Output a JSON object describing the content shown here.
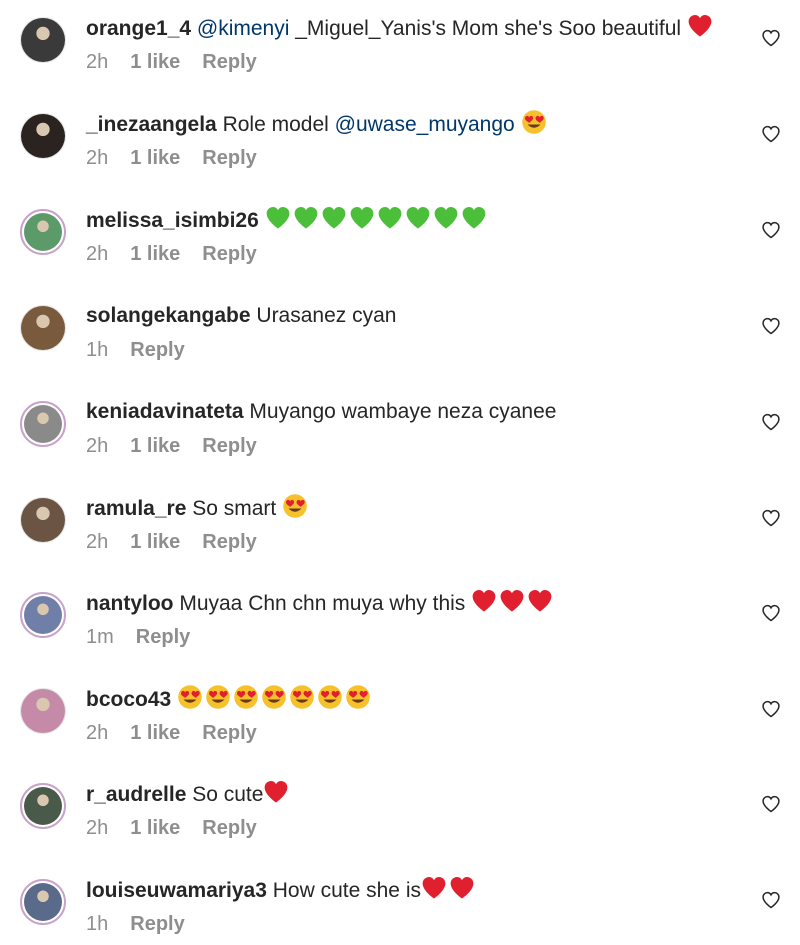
{
  "comments": [
    {
      "username": "orange1_4",
      "mention": "@kimenyi",
      "text": " _Miguel_Yanis's Mom she's Soo beautiful",
      "emoji": [
        "red-heart"
      ],
      "time": "2h",
      "likes": "1 like",
      "reply": "Reply",
      "avatar_color": "#3a3a3a",
      "avatar_ring": false
    },
    {
      "username": "_inezaangela",
      "text": " Role model ",
      "mention": "@uwase_muyango",
      "emoji": [
        "heart-eyes"
      ],
      "time": "2h",
      "likes": "1 like",
      "reply": "Reply",
      "avatar_color": "#2b2320",
      "avatar_ring": false
    },
    {
      "username": "melissa_isimbi26",
      "text": " ",
      "emoji": [
        "green-heart",
        "green-heart",
        "green-heart",
        "green-heart",
        "green-heart",
        "green-heart",
        "green-heart",
        "green-heart"
      ],
      "time": "2h",
      "likes": "1 like",
      "reply": "Reply",
      "avatar_color": "#5c9a6a",
      "avatar_ring": true
    },
    {
      "username": "solangekangabe",
      "text": " Urasanez cyan",
      "emoji": [],
      "time": "1h",
      "likes": "",
      "reply": "Reply",
      "avatar_color": "#7a5a3c",
      "avatar_ring": false
    },
    {
      "username": "keniadavinateta",
      "text": " Muyango wambaye neza cyanee",
      "emoji": [],
      "time": "2h",
      "likes": "1 like",
      "reply": "Reply",
      "avatar_color": "#8a8a8a",
      "avatar_ring": true
    },
    {
      "username": "ramula_re",
      "text": " So smart ",
      "emoji": [
        "heart-eyes"
      ],
      "time": "2h",
      "likes": "1 like",
      "reply": "Reply",
      "avatar_color": "#6b5444",
      "avatar_ring": false
    },
    {
      "username": "nantyloo",
      "text": " Muyaa Chn chn muya why this ",
      "emoji": [
        "red-heart",
        "red-heart",
        "red-heart"
      ],
      "time": "1m",
      "likes": "",
      "reply": "Reply",
      "avatar_color": "#6f7fa8",
      "avatar_ring": true
    },
    {
      "username": "bcoco43",
      "text": " ",
      "emoji": [
        "heart-eyes",
        "heart-eyes",
        "heart-eyes",
        "heart-eyes",
        "heart-eyes",
        "heart-eyes",
        "heart-eyes"
      ],
      "time": "2h",
      "likes": "1 like",
      "reply": "Reply",
      "avatar_color": "#c48aa8",
      "avatar_ring": false
    },
    {
      "username": "r_audrelle",
      "text": " So cute",
      "emoji": [
        "red-heart"
      ],
      "time": "2h",
      "likes": "1 like",
      "reply": "Reply",
      "avatar_color": "#4a5a4a",
      "avatar_ring": true
    },
    {
      "username": "louiseuwamariya3",
      "text": " How cute she is",
      "emoji": [
        "red-heart",
        "red-heart"
      ],
      "time": "1h",
      "likes": "",
      "reply": "Reply",
      "avatar_color": "#5a6a8a",
      "avatar_ring": true
    }
  ],
  "colors": {
    "text": "#262626",
    "meta": "#8e8e8e",
    "mention": "#00376b",
    "heart_red": "#e0202f",
    "heart_green": "#4bbf3a"
  },
  "icons": {
    "like": "heart-outline-icon"
  }
}
